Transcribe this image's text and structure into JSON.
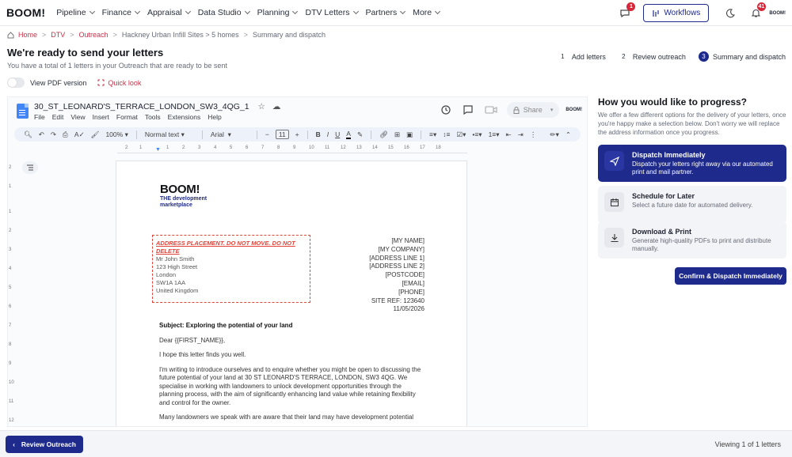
{
  "nav": {
    "logo": "BOOM!",
    "items": [
      {
        "label": "Pipeline"
      },
      {
        "label": "Finance"
      },
      {
        "label": "Appraisal"
      },
      {
        "label": "Data Studio"
      },
      {
        "label": "Planning"
      },
      {
        "label": "DTV Letters"
      },
      {
        "label": "Partners"
      },
      {
        "label": "More"
      }
    ],
    "messages_badge": "1",
    "workflows_label": "Workflows",
    "notifications_badge": "41",
    "avatar_logo": "BOOM!"
  },
  "breadcrumb": {
    "home": "Home",
    "dtv": "DTV",
    "outreach": "Outreach",
    "site": "Hackney Urban Infill Sites > 5 homes",
    "current": "Summary and dispatch"
  },
  "header": {
    "title": "We're ready to send your letters",
    "subtitle": "You have a total of 1 letters in your Outreach that are ready to be sent"
  },
  "steps": [
    {
      "num": "1",
      "label": "Add letters"
    },
    {
      "num": "2",
      "label": "Review outreach"
    },
    {
      "num": "3",
      "label": "Summary and dispatch"
    }
  ],
  "options_row": {
    "pdf_label": "View PDF version",
    "quick_look": "Quick look"
  },
  "doc": {
    "title": "30_ST_LEONARD'S_TERRACE_LONDON_SW3_4QG_1",
    "menu": [
      "File",
      "Edit",
      "View",
      "Insert",
      "Format",
      "Tools",
      "Extensions",
      "Help"
    ],
    "share": "Share",
    "head_logo": "BOOM!",
    "toolbar": {
      "zoom": "100%",
      "style": "Normal text",
      "font": "Arial",
      "size": "11"
    },
    "ruler": [
      "2",
      "1",
      "1",
      "2",
      "3",
      "4",
      "5",
      "6",
      "7",
      "8",
      "9",
      "10",
      "11",
      "12",
      "13",
      "14",
      "15",
      "16",
      "17",
      "18"
    ],
    "vruler": [
      "2",
      "1",
      "1",
      "2",
      "3",
      "4",
      "5",
      "6",
      "7",
      "8",
      "9",
      "10",
      "11",
      "12"
    ],
    "letter": {
      "logo_big": "BOOM!",
      "logo_sub1": "THE development",
      "logo_sub2": "marketplace",
      "address_warning": "ADDRESS PLACEMENT. DO NOT MOVE. DO NOT DELETE",
      "address_lines": [
        "Mr John Smith",
        "123 High Street",
        "London",
        "SW1A 1AA",
        "United Kingdom"
      ],
      "sender_lines": [
        "[MY NAME]",
        "[MY COMPANY]",
        "[ADDRESS LINE 1]",
        "[ADDRESS LINE 2]",
        "[POSTCODE]",
        "[EMAIL]",
        "[PHONE]",
        "SITE REF: 123640",
        "11/05/2026"
      ],
      "subject": "Subject: Exploring the potential of your land",
      "greeting": "Dear {{FIRST_NAME}},",
      "p1": "I hope this letter finds you well.",
      "p2": "I'm writing to introduce ourselves and to enquire whether you might be open to discussing the future potential of your land at 30 ST LEONARD'S TERRACE, LONDON, SW3 4QG. We specialise in working with landowners to unlock development opportunities through the planning process, with the aim of significantly enhancing land value while retaining flexibility and control for the owner.",
      "p3": "Many landowners we speak with are aware that their land may have development potential"
    }
  },
  "progress": {
    "title": "How you would like to progress?",
    "description": "We offer a few different options for the delivery of your letters, once you're happy make a selection below. Don't worry we will replace the address information once you progress.",
    "options": [
      {
        "title": "Dispatch Immediately",
        "desc": "Dispatch your letters right away via our automated print and mail partner."
      },
      {
        "title": "Schedule for Later",
        "desc": "Select a future date for automated delivery."
      },
      {
        "title": "Download & Print",
        "desc": "Generate high-quality PDFs to print and distribute manually."
      }
    ],
    "confirm": "Confirm & Dispatch Immediately"
  },
  "footer": {
    "review": "Review Outreach",
    "viewing": "Viewing 1 of 1 letters"
  },
  "colors": {
    "brand": "#1e2a8c",
    "accent_red": "#c63247",
    "warning_red": "#e0443a"
  }
}
